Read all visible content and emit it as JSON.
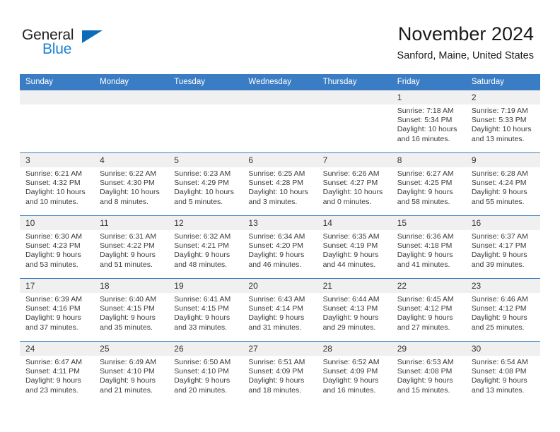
{
  "logo": {
    "word_one": "General",
    "word_two": "Blue",
    "triangle_icon": "triangle-icon"
  },
  "header": {
    "title": "November 2024",
    "subtitle": "Sanford, Maine, United States"
  },
  "colors": {
    "header_blue": "#3b7dc4",
    "logo_blue": "#1b7fd4",
    "daynum_bg": "#f0f0f0",
    "text": "#3a3a3a"
  },
  "labels": {
    "sunrise": "Sunrise:",
    "sunset": "Sunset:",
    "daylight": "Daylight:"
  },
  "weekdays": [
    "Sunday",
    "Monday",
    "Tuesday",
    "Wednesday",
    "Thursday",
    "Friday",
    "Saturday"
  ],
  "weeks": [
    [
      {
        "day": "",
        "sunrise": "",
        "sunset": "",
        "daylight": "",
        "empty": true
      },
      {
        "day": "",
        "sunrise": "",
        "sunset": "",
        "daylight": "",
        "empty": true
      },
      {
        "day": "",
        "sunrise": "",
        "sunset": "",
        "daylight": "",
        "empty": true
      },
      {
        "day": "",
        "sunrise": "",
        "sunset": "",
        "daylight": "",
        "empty": true
      },
      {
        "day": "",
        "sunrise": "",
        "sunset": "",
        "daylight": "",
        "empty": true
      },
      {
        "day": "1",
        "sunrise": "Sunrise: 7:18 AM",
        "sunset": "Sunset: 5:34 PM",
        "daylight": "Daylight: 10 hours and 16 minutes.",
        "empty": false
      },
      {
        "day": "2",
        "sunrise": "Sunrise: 7:19 AM",
        "sunset": "Sunset: 5:33 PM",
        "daylight": "Daylight: 10 hours and 13 minutes.",
        "empty": false
      }
    ],
    [
      {
        "day": "3",
        "sunrise": "Sunrise: 6:21 AM",
        "sunset": "Sunset: 4:32 PM",
        "daylight": "Daylight: 10 hours and 10 minutes.",
        "empty": false
      },
      {
        "day": "4",
        "sunrise": "Sunrise: 6:22 AM",
        "sunset": "Sunset: 4:30 PM",
        "daylight": "Daylight: 10 hours and 8 minutes.",
        "empty": false
      },
      {
        "day": "5",
        "sunrise": "Sunrise: 6:23 AM",
        "sunset": "Sunset: 4:29 PM",
        "daylight": "Daylight: 10 hours and 5 minutes.",
        "empty": false
      },
      {
        "day": "6",
        "sunrise": "Sunrise: 6:25 AM",
        "sunset": "Sunset: 4:28 PM",
        "daylight": "Daylight: 10 hours and 3 minutes.",
        "empty": false
      },
      {
        "day": "7",
        "sunrise": "Sunrise: 6:26 AM",
        "sunset": "Sunset: 4:27 PM",
        "daylight": "Daylight: 10 hours and 0 minutes.",
        "empty": false
      },
      {
        "day": "8",
        "sunrise": "Sunrise: 6:27 AM",
        "sunset": "Sunset: 4:25 PM",
        "daylight": "Daylight: 9 hours and 58 minutes.",
        "empty": false
      },
      {
        "day": "9",
        "sunrise": "Sunrise: 6:28 AM",
        "sunset": "Sunset: 4:24 PM",
        "daylight": "Daylight: 9 hours and 55 minutes.",
        "empty": false
      }
    ],
    [
      {
        "day": "10",
        "sunrise": "Sunrise: 6:30 AM",
        "sunset": "Sunset: 4:23 PM",
        "daylight": "Daylight: 9 hours and 53 minutes.",
        "empty": false
      },
      {
        "day": "11",
        "sunrise": "Sunrise: 6:31 AM",
        "sunset": "Sunset: 4:22 PM",
        "daylight": "Daylight: 9 hours and 51 minutes.",
        "empty": false
      },
      {
        "day": "12",
        "sunrise": "Sunrise: 6:32 AM",
        "sunset": "Sunset: 4:21 PM",
        "daylight": "Daylight: 9 hours and 48 minutes.",
        "empty": false
      },
      {
        "day": "13",
        "sunrise": "Sunrise: 6:34 AM",
        "sunset": "Sunset: 4:20 PM",
        "daylight": "Daylight: 9 hours and 46 minutes.",
        "empty": false
      },
      {
        "day": "14",
        "sunrise": "Sunrise: 6:35 AM",
        "sunset": "Sunset: 4:19 PM",
        "daylight": "Daylight: 9 hours and 44 minutes.",
        "empty": false
      },
      {
        "day": "15",
        "sunrise": "Sunrise: 6:36 AM",
        "sunset": "Sunset: 4:18 PM",
        "daylight": "Daylight: 9 hours and 41 minutes.",
        "empty": false
      },
      {
        "day": "16",
        "sunrise": "Sunrise: 6:37 AM",
        "sunset": "Sunset: 4:17 PM",
        "daylight": "Daylight: 9 hours and 39 minutes.",
        "empty": false
      }
    ],
    [
      {
        "day": "17",
        "sunrise": "Sunrise: 6:39 AM",
        "sunset": "Sunset: 4:16 PM",
        "daylight": "Daylight: 9 hours and 37 minutes.",
        "empty": false
      },
      {
        "day": "18",
        "sunrise": "Sunrise: 6:40 AM",
        "sunset": "Sunset: 4:15 PM",
        "daylight": "Daylight: 9 hours and 35 minutes.",
        "empty": false
      },
      {
        "day": "19",
        "sunrise": "Sunrise: 6:41 AM",
        "sunset": "Sunset: 4:15 PM",
        "daylight": "Daylight: 9 hours and 33 minutes.",
        "empty": false
      },
      {
        "day": "20",
        "sunrise": "Sunrise: 6:43 AM",
        "sunset": "Sunset: 4:14 PM",
        "daylight": "Daylight: 9 hours and 31 minutes.",
        "empty": false
      },
      {
        "day": "21",
        "sunrise": "Sunrise: 6:44 AM",
        "sunset": "Sunset: 4:13 PM",
        "daylight": "Daylight: 9 hours and 29 minutes.",
        "empty": false
      },
      {
        "day": "22",
        "sunrise": "Sunrise: 6:45 AM",
        "sunset": "Sunset: 4:12 PM",
        "daylight": "Daylight: 9 hours and 27 minutes.",
        "empty": false
      },
      {
        "day": "23",
        "sunrise": "Sunrise: 6:46 AM",
        "sunset": "Sunset: 4:12 PM",
        "daylight": "Daylight: 9 hours and 25 minutes.",
        "empty": false
      }
    ],
    [
      {
        "day": "24",
        "sunrise": "Sunrise: 6:47 AM",
        "sunset": "Sunset: 4:11 PM",
        "daylight": "Daylight: 9 hours and 23 minutes.",
        "empty": false
      },
      {
        "day": "25",
        "sunrise": "Sunrise: 6:49 AM",
        "sunset": "Sunset: 4:10 PM",
        "daylight": "Daylight: 9 hours and 21 minutes.",
        "empty": false
      },
      {
        "day": "26",
        "sunrise": "Sunrise: 6:50 AM",
        "sunset": "Sunset: 4:10 PM",
        "daylight": "Daylight: 9 hours and 20 minutes.",
        "empty": false
      },
      {
        "day": "27",
        "sunrise": "Sunrise: 6:51 AM",
        "sunset": "Sunset: 4:09 PM",
        "daylight": "Daylight: 9 hours and 18 minutes.",
        "empty": false
      },
      {
        "day": "28",
        "sunrise": "Sunrise: 6:52 AM",
        "sunset": "Sunset: 4:09 PM",
        "daylight": "Daylight: 9 hours and 16 minutes.",
        "empty": false
      },
      {
        "day": "29",
        "sunrise": "Sunrise: 6:53 AM",
        "sunset": "Sunset: 4:08 PM",
        "daylight": "Daylight: 9 hours and 15 minutes.",
        "empty": false
      },
      {
        "day": "30",
        "sunrise": "Sunrise: 6:54 AM",
        "sunset": "Sunset: 4:08 PM",
        "daylight": "Daylight: 9 hours and 13 minutes.",
        "empty": false
      }
    ]
  ]
}
